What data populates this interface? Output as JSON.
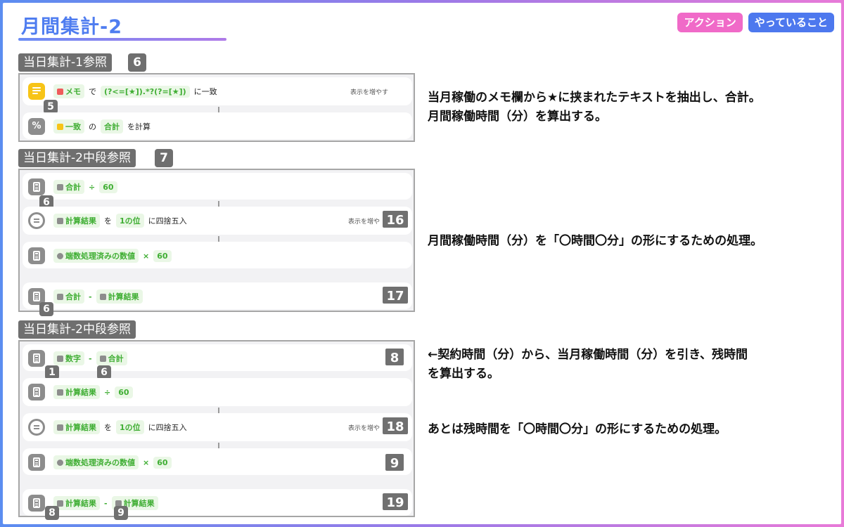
{
  "title": "月間集計-2",
  "legend": {
    "action": "アクション",
    "doing": "やっていること"
  },
  "sections": [
    {
      "label": "当日集計-1参照",
      "num": "6",
      "rows": [
        {
          "badge": "5",
          "parts": {
            "tok1": "メモ",
            "t1": "で",
            "tok2": "(?<=[★]).*?(?=[★])",
            "t2": "に一致"
          },
          "expand": "表示を増やす"
        },
        {
          "parts": {
            "tok1": "一致",
            "t1": "の",
            "tok2": "合計",
            "t2": "を計算"
          }
        }
      ]
    },
    {
      "label": "当日集計-2中段参照",
      "num": "7",
      "rows": [
        {
          "badge": "6",
          "parts": {
            "tok1": "合計",
            "op": "÷",
            "tok2": "60"
          }
        },
        {
          "parts": {
            "tok1": "計算結果",
            "t1": "を",
            "tok2": "1の位",
            "t2": "に四捨五入"
          },
          "expand": "表示を増や",
          "tag": "16"
        },
        {
          "parts": {
            "tok1": "端数処理済みの数値",
            "op": "×",
            "tok2": "60"
          }
        },
        {
          "badge": "6",
          "parts": {
            "tok1": "合計",
            "op": "-",
            "tok2": "計算結果"
          },
          "tag": "17"
        }
      ]
    },
    {
      "label": "当日集計-2中段参照",
      "rows": [
        {
          "badge": "1",
          "badge2": "6",
          "parts": {
            "tok1": "数字",
            "op": "-",
            "tok2": "合計"
          },
          "tag": "8"
        },
        {
          "parts": {
            "tok1": "計算結果",
            "op": "÷",
            "tok2": "60"
          }
        },
        {
          "parts": {
            "tok1": "計算結果",
            "t1": "を",
            "tok2": "1の位",
            "t2": "に四捨五入"
          },
          "expand": "表示を増や",
          "tag": "18"
        },
        {
          "parts": {
            "tok1": "端数処理済みの数値",
            "op": "×",
            "tok2": "60"
          },
          "tag": "9"
        },
        {
          "badge": "8",
          "badge2": "9",
          "parts": {
            "tok1": "計算結果",
            "op": "-",
            "tok2": "計算結果"
          },
          "tag": "19"
        }
      ]
    }
  ],
  "descriptions": {
    "d1": "当月稼働のメモ欄から★に挟まれたテキストを抽出し、合計。",
    "d2": "月間稼働時間（分）を算出する。",
    "d3": "月間稼働時間（分）を「〇時間〇分」の形にするための処理。",
    "d4": "←契約時間（分）から、当月稼働時間（分）を引き、残時間",
    "d5": "を算出する。",
    "d6": "あとは残時間を「〇時間〇分」の形にするための処理。"
  }
}
